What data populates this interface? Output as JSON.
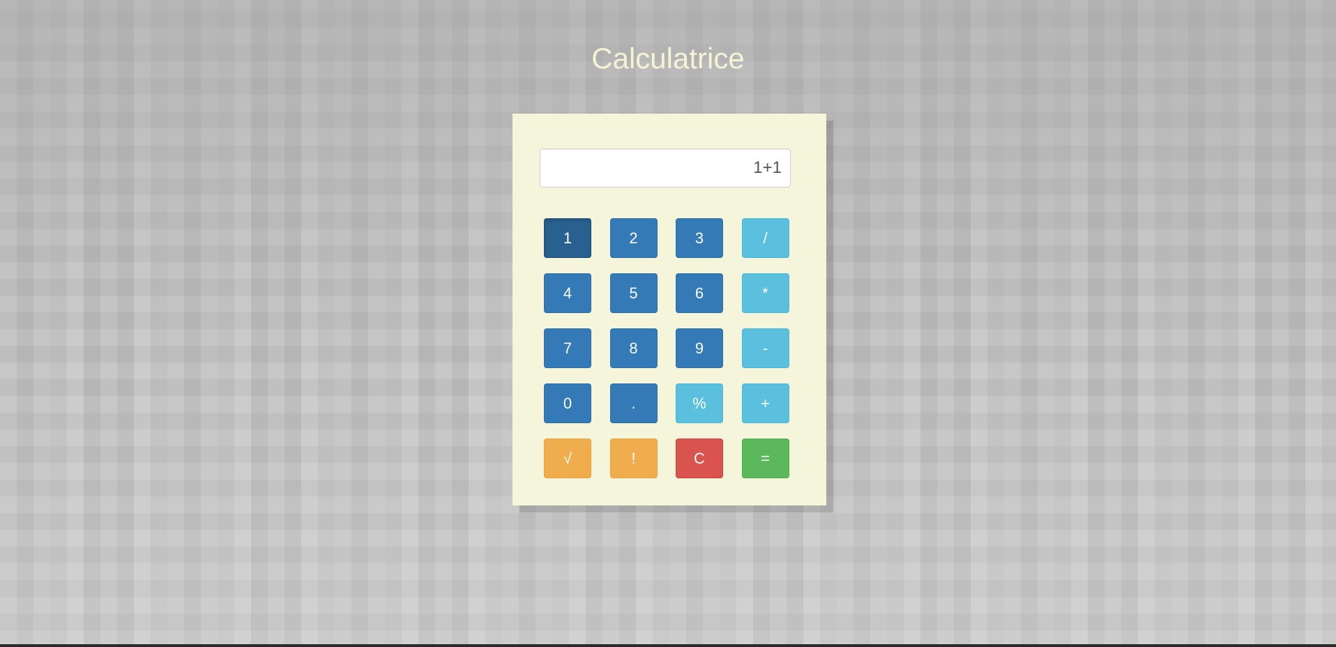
{
  "page": {
    "title": "Calculatrice"
  },
  "display": {
    "value": "1+1"
  },
  "keys": [
    {
      "label": "1",
      "name": "key-1-button",
      "style": "primary active"
    },
    {
      "label": "2",
      "name": "key-2-button",
      "style": "primary"
    },
    {
      "label": "3",
      "name": "key-3-button",
      "style": "primary"
    },
    {
      "label": "/",
      "name": "divide-button",
      "style": "info"
    },
    {
      "label": "4",
      "name": "key-4-button",
      "style": "primary"
    },
    {
      "label": "5",
      "name": "key-5-button",
      "style": "primary"
    },
    {
      "label": "6",
      "name": "key-6-button",
      "style": "primary"
    },
    {
      "label": "*",
      "name": "multiply-button",
      "style": "info"
    },
    {
      "label": "7",
      "name": "key-7-button",
      "style": "primary"
    },
    {
      "label": "8",
      "name": "key-8-button",
      "style": "primary"
    },
    {
      "label": "9",
      "name": "key-9-button",
      "style": "primary"
    },
    {
      "label": "-",
      "name": "subtract-button",
      "style": "info"
    },
    {
      "label": "0",
      "name": "key-0-button",
      "style": "primary"
    },
    {
      "label": ".",
      "name": "decimal-point-button",
      "style": "primary"
    },
    {
      "label": "%",
      "name": "percent-button",
      "style": "info"
    },
    {
      "label": "+",
      "name": "add-button",
      "style": "info"
    },
    {
      "label": "√",
      "name": "square-root-button",
      "style": "warning"
    },
    {
      "label": "!",
      "name": "factorial-button",
      "style": "warning"
    },
    {
      "label": "C",
      "name": "clear-button",
      "style": "danger"
    },
    {
      "label": "=",
      "name": "equals-button",
      "style": "success"
    }
  ],
  "colors": {
    "primary": "#337ab7",
    "primary_active": "#286090",
    "info": "#5bc0de",
    "warning": "#f0ad4e",
    "danger": "#d9534f",
    "success": "#5cb85c",
    "panel": "#f5f5dc",
    "title": "#f5f3d6"
  }
}
